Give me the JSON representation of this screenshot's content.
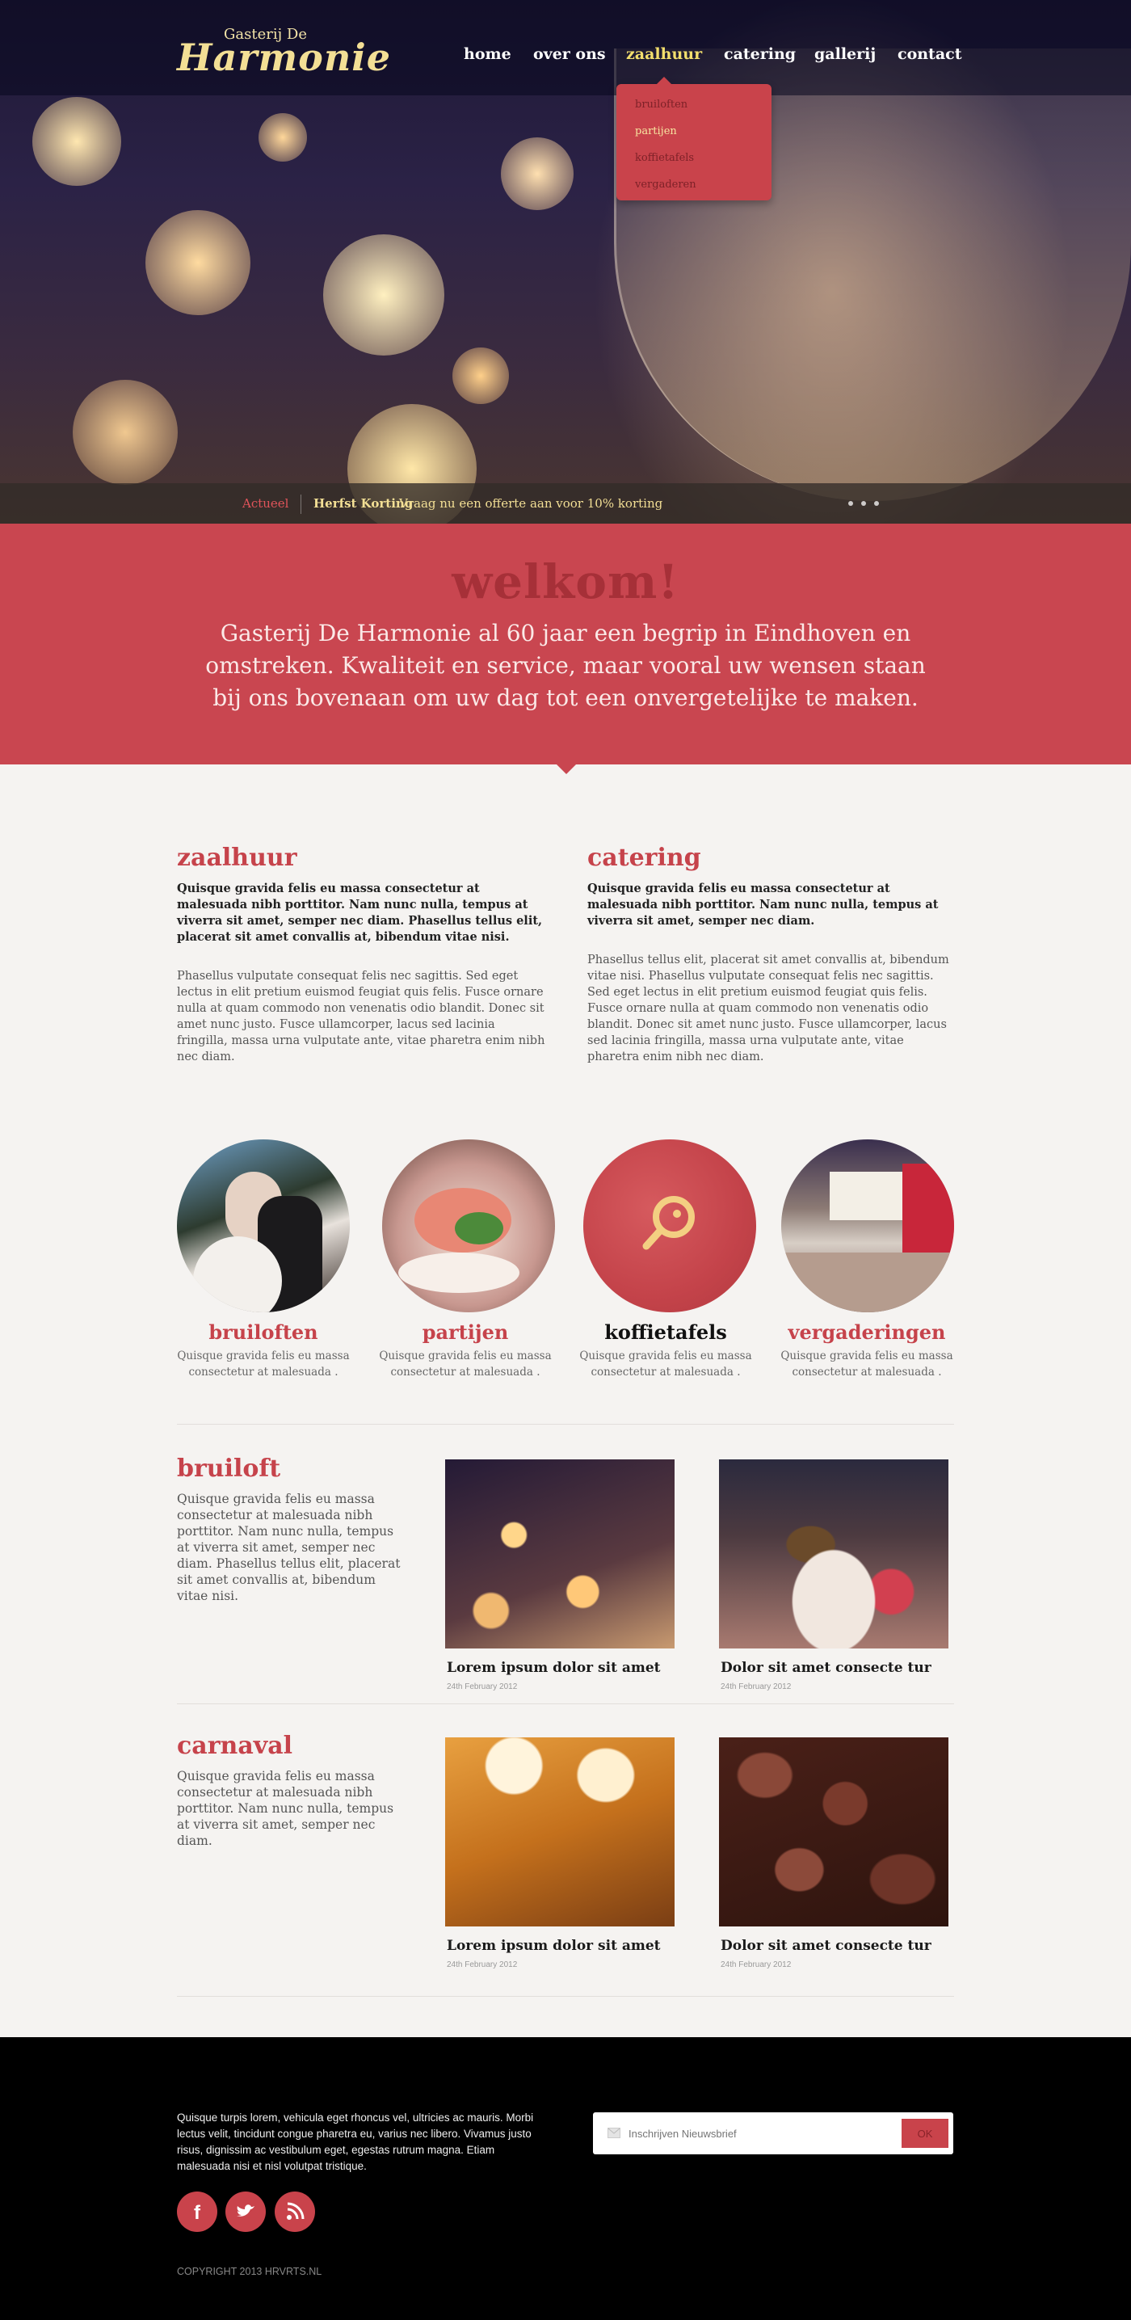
{
  "brand": {
    "small": "Gasterij De",
    "big": "Harmonie"
  },
  "nav": {
    "items": [
      {
        "label": "home"
      },
      {
        "label": "over ons"
      },
      {
        "label": "zaalhuur"
      },
      {
        "label": "catering"
      },
      {
        "label": "gallerij"
      },
      {
        "label": "contact"
      }
    ],
    "active": "zaalhuur",
    "dropdown": [
      "bruiloften",
      "partijen",
      "koffietafels",
      "vergaderen"
    ],
    "dropdown_selected": "partijen"
  },
  "ticker": {
    "tag": "Actueel",
    "title": "Herfst Korting",
    "text": "Vraag nu een offerte aan voor 10% korting"
  },
  "welcome": {
    "title": "welkom!",
    "text": "Gasterij De Harmonie al 60 jaar een begrip in Eindhoven en omstreken. Kwaliteit en service, maar vooral uw wensen staan bij ons bovenaan om uw dag tot een onvergetelijke te maken."
  },
  "columns": [
    {
      "title": "zaalhuur",
      "lead": "Quisque gravida felis eu massa consectetur at malesuada nibh porttitor. Nam nunc nulla, tempus at viverra sit amet, semper nec diam. Phasellus tellus elit, placerat sit amet convallis at, bibendum vitae nisi.",
      "body": "Phasellus vulputate consequat felis nec sagittis. Sed eget lectus in elit pretium euismod feugiat quis felis. Fusce ornare nulla at quam commodo non venenatis odio blandit. Donec sit amet nunc justo. Fusce ullamcorper, lacus sed lacinia fringilla, massa urna vulputate ante, vitae pharetra enim nibh nec diam."
    },
    {
      "title": "catering",
      "lead": "Quisque gravida felis eu massa consectetur at malesuada nibh porttitor. Nam nunc nulla, tempus at viverra sit amet, semper nec diam.",
      "body": "Phasellus tellus elit, placerat sit amet convallis at, bibendum vitae nisi.  Phasellus vulputate consequat felis nec sagittis. Sed eget lectus in elit pretium euismod feugiat quis felis. Fusce ornare nulla at quam commodo non venenatis odio blandit. Donec sit amet nunc justo. Fusce ullamcorper, lacus sed lacinia fringilla, massa urna vulputate ante, vitae pharetra enim nibh nec diam."
    }
  ],
  "features": [
    {
      "title": "bruiloften",
      "text": "Quisque gravida felis eu massa consectetur at malesuada ."
    },
    {
      "title": "partijen",
      "text": "Quisque gravida felis eu massa consectetur at malesuada ."
    },
    {
      "title": "koffietafels",
      "text": "Quisque gravida felis eu massa consectetur at malesuada ."
    },
    {
      "title": "vergaderingen",
      "text": "Quisque gravida felis eu massa consectetur at malesuada ."
    }
  ],
  "sections": [
    {
      "title": "bruiloft",
      "text": "Quisque gravida felis eu massa consectetur at malesuada nibh porttitor. Nam nunc nulla, tempus at viverra sit amet, semper nec diam. Phasellus tellus elit, placerat sit amet convallis at, bibendum vitae nisi.",
      "cards": [
        {
          "title": "Lorem ipsum dolor sit amet",
          "date": "24th February 2012"
        },
        {
          "title": "Dolor sit amet consecte tur",
          "date": "24th February 2012"
        }
      ]
    },
    {
      "title": "carnaval",
      "text": "Quisque gravida felis eu massa consectetur at malesuada nibh porttitor. Nam nunc nulla, tempus at viverra sit amet, semper nec diam.",
      "cards": [
        {
          "title": "Lorem ipsum dolor sit amet",
          "date": "24th February 2012"
        },
        {
          "title": "Dolor sit amet consecte tur",
          "date": "24th February 2012"
        }
      ]
    }
  ],
  "footer": {
    "text": "Quisque turpis lorem, vehicula eget rhoncus vel, ultricies ac mauris. Morbi lectus velit, tincidunt congue pharetra eu, varius nec libero. Vivamus justo risus, dignissim ac vestibulum eget, egestas rutrum magna. Etiam malesuada nisi et nisl volutpat tristique.",
    "newsletter_placeholder": "Inschrijven Nieuwsbrief",
    "newsletter_button": "OK",
    "copyright": "COPYRIGHT 2013 HRVRTS.NL",
    "social": [
      "facebook-icon",
      "twitter-icon",
      "rss-icon"
    ]
  },
  "colors": {
    "accent": "#c9434b",
    "gold": "#f3df95",
    "footer_bg": "#000000"
  }
}
